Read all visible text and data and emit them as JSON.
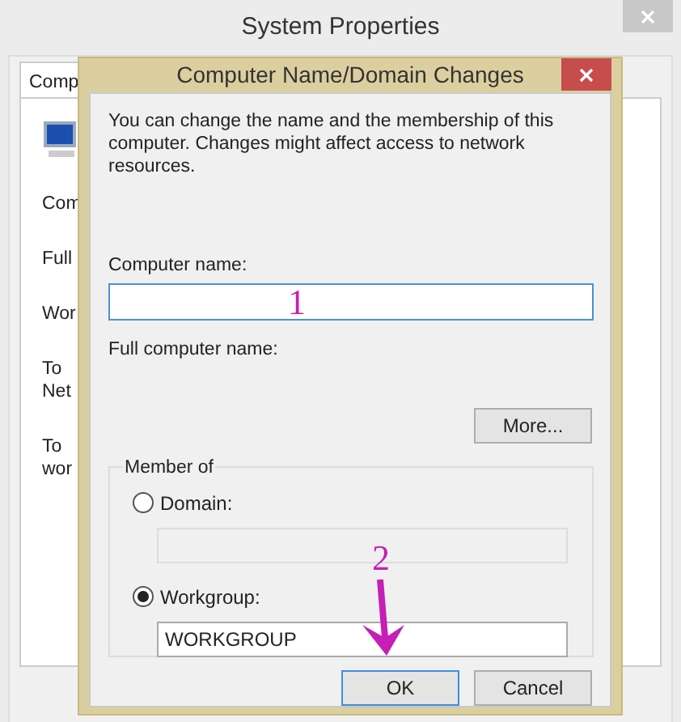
{
  "window": {
    "title": "System Properties"
  },
  "background_tab": {
    "label": "Comp",
    "selected": true
  },
  "background_texts": [
    "Com",
    "Full",
    "Wor",
    "To\nNet",
    "To\nwor"
  ],
  "dialog": {
    "title": "Computer Name/Domain Changes",
    "intro": "You can change the name and the membership of this computer. Changes might affect access to network resources.",
    "computer_name_label": "Computer name:",
    "full_name_label": "Full computer name:",
    "more_button": "More...",
    "member_of": {
      "title": "Member of",
      "options": [
        {
          "label": "Domain:",
          "selected": false
        },
        {
          "label": "Workgroup:",
          "selected": true,
          "value": "WORKGROUP"
        }
      ]
    },
    "buttons": [
      {
        "label": "OK",
        "focused": true
      },
      {
        "label": "Cancel",
        "focused": false
      }
    ]
  },
  "annotations": [
    {
      "text": "1"
    },
    {
      "text": "2"
    }
  ]
}
